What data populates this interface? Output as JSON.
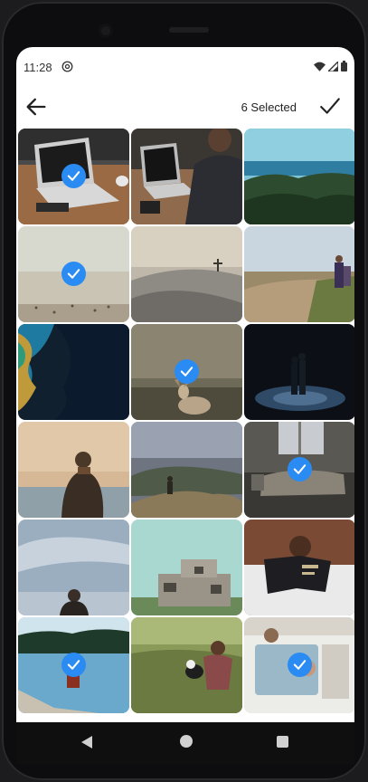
{
  "status_bar": {
    "time": "11:28",
    "icons": [
      "at-sign-icon",
      "wifi-icon",
      "signal-icon",
      "battery-icon"
    ]
  },
  "app_bar": {
    "back_icon": "arrow-left-icon",
    "selected_label": "6 Selected",
    "confirm_icon": "check-icon"
  },
  "colors": {
    "accent": "#2a8bf2",
    "background": "#ffffff"
  },
  "photos": [
    {
      "subject": "laptop on wooden desk",
      "selected": true
    },
    {
      "subject": "person typing on laptop",
      "selected": false
    },
    {
      "subject": "sea and forest landscape",
      "selected": false
    },
    {
      "subject": "misty beach",
      "selected": true
    },
    {
      "subject": "sand dunes with cross",
      "selected": false
    },
    {
      "subject": "couple walking on path",
      "selected": false
    },
    {
      "subject": "aerial coastline",
      "selected": false
    },
    {
      "subject": "deer in forest",
      "selected": true
    },
    {
      "subject": "couple in dark night",
      "selected": false
    },
    {
      "subject": "person by the lake",
      "selected": false
    },
    {
      "subject": "person on rocky hill",
      "selected": false
    },
    {
      "subject": "bed by window",
      "selected": true
    },
    {
      "subject": "person under sky",
      "selected": false
    },
    {
      "subject": "old concrete fort",
      "selected": false
    },
    {
      "subject": "child reading bible",
      "selected": false
    },
    {
      "subject": "canoe on lake",
      "selected": true
    },
    {
      "subject": "person with dog in grass",
      "selected": false
    },
    {
      "subject": "couple in vintage car",
      "selected": true
    }
  ],
  "nav_bar": {
    "icons": [
      "nav-back-icon",
      "nav-home-icon",
      "nav-recents-icon"
    ]
  }
}
